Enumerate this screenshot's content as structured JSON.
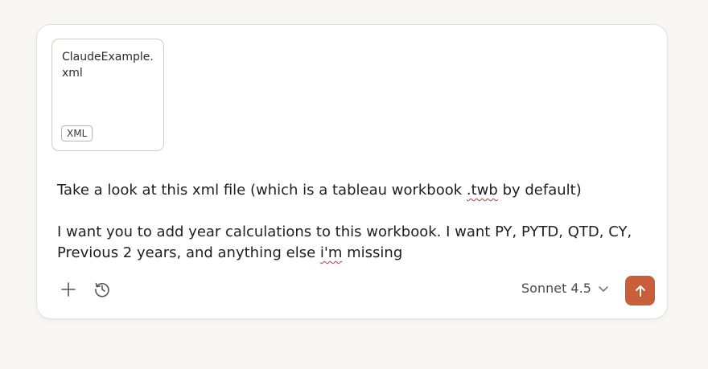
{
  "attachment": {
    "filename": "ClaudeExample.xml",
    "type_badge": "XML",
    "icon": "file-attachment-icon"
  },
  "message": {
    "line1_before": "Take a look at this xml file (which is a tableau workbook ",
    "line1_flagged": ".twb",
    "line1_after": " by default)",
    "line2_before": "I want you to add year calculations to this workbook. I want PY, PYTD, QTD, CY, Previous 2 years, and anything else ",
    "line2_flagged": "i'm",
    "line2_after": " missing"
  },
  "toolbar": {
    "add_icon": "plus-icon",
    "history_icon": "clock-history-icon",
    "model_name": "Sonnet 4.5",
    "model_dropdown_icon": "chevron-down-icon",
    "send_icon": "arrow-up-icon"
  },
  "colors": {
    "background": "#f8f7f4",
    "send_button": "#c85f3a",
    "spellcheck": "#d0312d"
  }
}
